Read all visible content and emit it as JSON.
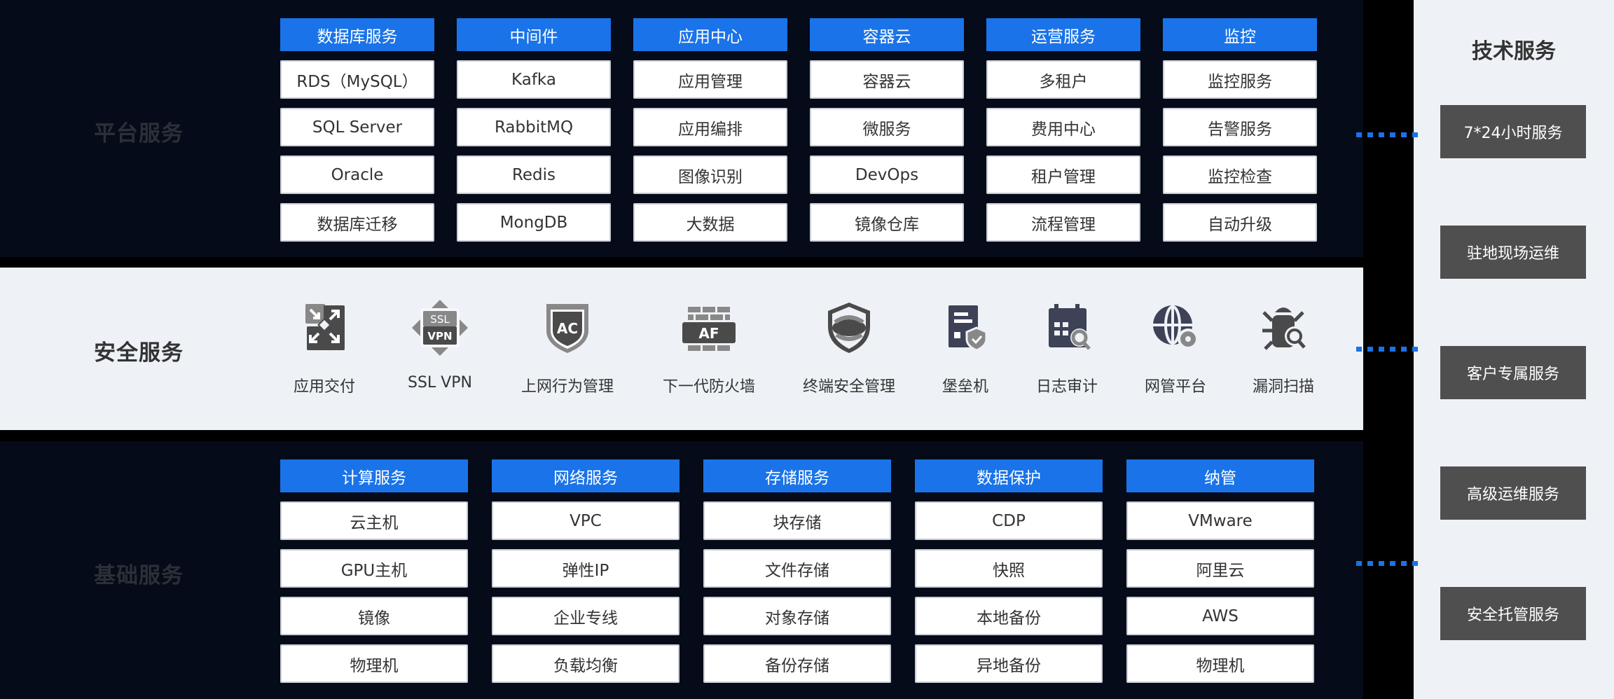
{
  "platform": {
    "title": "平台服务",
    "columns": [
      {
        "header": "数据库服务",
        "items": [
          "RDS（MySQL）",
          "SQL Server",
          "Oracle",
          "数据库迁移"
        ]
      },
      {
        "header": "中间件",
        "items": [
          "Kafka",
          "RabbitMQ",
          "Redis",
          "MongDB"
        ]
      },
      {
        "header": "应用中心",
        "items": [
          "应用管理",
          "应用编排",
          "图像识别",
          "大数据"
        ]
      },
      {
        "header": "容器云",
        "items": [
          "容器云",
          "微服务",
          "DevOps",
          "镜像仓库"
        ]
      },
      {
        "header": "运营服务",
        "items": [
          "多租户",
          "费用中心",
          "租户管理",
          "流程管理"
        ]
      },
      {
        "header": "监控",
        "items": [
          "监控服务",
          "告警服务",
          "监控检查",
          "自动升级"
        ]
      }
    ]
  },
  "security": {
    "title": "安全服务",
    "items": [
      {
        "label": "应用交付",
        "icon": "app-delivery-icon"
      },
      {
        "label": "SSL VPN",
        "icon": "ssl-vpn-icon"
      },
      {
        "label": "上网行为管理",
        "icon": "ac-shield-icon"
      },
      {
        "label": "下一代防火墙",
        "icon": "firewall-af-icon"
      },
      {
        "label": "终端安全管理",
        "icon": "endpoint-shield-icon"
      },
      {
        "label": "堡垒机",
        "icon": "bastion-server-icon"
      },
      {
        "label": "日志审计",
        "icon": "calendar-search-icon"
      },
      {
        "label": "网管平台",
        "icon": "globe-gear-icon"
      },
      {
        "label": "漏洞扫描",
        "icon": "bug-search-icon"
      }
    ],
    "icon_texts": {
      "ssl": "SSL",
      "vpn": "VPN",
      "ac": "AC",
      "af": "AF"
    }
  },
  "base": {
    "title": "基础服务",
    "columns": [
      {
        "header": "计算服务",
        "items": [
          "云主机",
          "GPU主机",
          "镜像",
          "物理机"
        ]
      },
      {
        "header": "网络服务",
        "items": [
          "VPC",
          "弹性IP",
          "企业专线",
          "负载均衡"
        ]
      },
      {
        "header": "存储服务",
        "items": [
          "块存储",
          "文件存储",
          "对象存储",
          "备份存储"
        ]
      },
      {
        "header": "数据保护",
        "items": [
          "CDP",
          "快照",
          "本地备份",
          "异地备份"
        ]
      },
      {
        "header": "纳管",
        "items": [
          "VMware",
          "阿里云",
          "AWS",
          "物理机"
        ]
      }
    ]
  },
  "tech": {
    "title": "技术服务",
    "items": [
      "7*24小时服务",
      "驻地现场运维",
      "客户专属服务",
      "高级运维服务",
      "安全托管服务"
    ]
  },
  "colors": {
    "accent_blue": "#1a73e8",
    "dark_panel": "#050b18",
    "light_panel": "#eef2f7",
    "tech_button": "#4f4f4f"
  }
}
